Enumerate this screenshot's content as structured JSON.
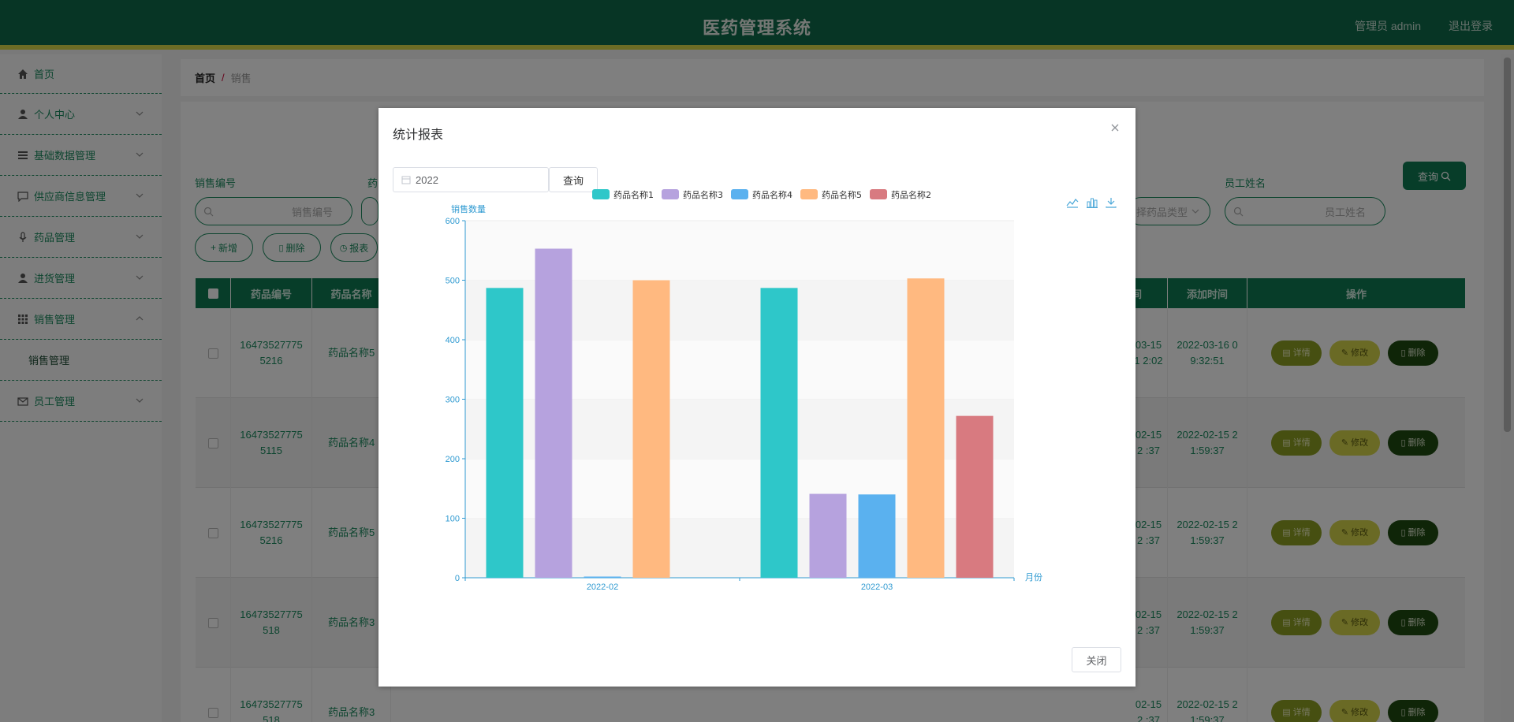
{
  "header": {
    "title": "医药管理系统",
    "user": "管理员 admin",
    "logout": "退出登录"
  },
  "sidebar": {
    "items": [
      {
        "label": "首页",
        "icon": "home-icon"
      },
      {
        "label": "个人中心",
        "icon": "user-icon"
      },
      {
        "label": "基础数据管理",
        "icon": "list-icon"
      },
      {
        "label": "供应商信息管理",
        "icon": "chat-icon"
      },
      {
        "label": "药品管理",
        "icon": "mic-icon"
      },
      {
        "label": "进货管理",
        "icon": "user-icon"
      },
      {
        "label": "销售管理",
        "icon": "grid-icon"
      },
      {
        "label": "员工管理",
        "icon": "mail-icon"
      }
    ],
    "submenu": "销售管理"
  },
  "breadcrumb": {
    "home": "首页",
    "sep": "/",
    "current": "销售"
  },
  "filters": {
    "sale_no_label": "销售编号",
    "sale_no_placeholder": "销售编号",
    "drug_label_partial": "药",
    "drug_type_placeholder": "择药品类型",
    "staff_label": "员工姓名",
    "staff_placeholder": "员工姓名",
    "query": "查询"
  },
  "actions": {
    "add": "新增",
    "delete": "删除",
    "report": "报表"
  },
  "table": {
    "headers": {
      "no": "药品编号",
      "name": "药品名称",
      "time_partial": "间",
      "added": "添加时间",
      "ops": "操作"
    },
    "rows": [
      {
        "no": "16473527775 5216",
        "name": "药品名称5",
        "time": "03-15 1 2:02",
        "added": "2022-03-16 0 9:32:51"
      },
      {
        "no": "16473527775 5115",
        "name": "药品名称4",
        "time": "02-15 2 :37",
        "added": "2022-02-15 2 1:59:37"
      },
      {
        "no": "16473527775 5216",
        "name": "药品名称5",
        "time": "02-15 2 :37",
        "added": "2022-02-15 2 1:59:37"
      },
      {
        "no": "16473527775 518",
        "name": "药品名称3",
        "time": "02-15 2 :37",
        "added": "2022-02-15 2 1:59:37"
      },
      {
        "no": "16473527775 518",
        "name": "药品名称3",
        "time": "02-15 2 :37",
        "added": "2022-02-15 2 1:59:37"
      }
    ],
    "btn_detail": "详情",
    "btn_edit": "修改",
    "btn_delete": "删除"
  },
  "dialog": {
    "title": "统计报表",
    "year_value": "2022",
    "query": "查询",
    "close": "关闭"
  },
  "chart_data": {
    "type": "bar",
    "categories": [
      "2022-02",
      "2022-03"
    ],
    "ylabel": "销售数量",
    "xlabel": "月份",
    "ylim": [
      0,
      600
    ],
    "yticks": [
      0,
      100,
      200,
      300,
      400,
      500,
      600
    ],
    "series": [
      {
        "name": "药品名称1",
        "color": "#2ec7c9",
        "values": [
          487,
          487
        ]
      },
      {
        "name": "药品名称3",
        "color": "#b6a2de",
        "values": [
          553,
          141
        ]
      },
      {
        "name": "药品名称4",
        "color": "#5ab1ef",
        "values": [
          2,
          140
        ]
      },
      {
        "name": "药品名称5",
        "color": "#ffb980",
        "values": [
          500,
          503
        ]
      },
      {
        "name": "药品名称2",
        "color": "#d87a80",
        "values": [
          0,
          272
        ]
      }
    ],
    "legend_position": "top-center",
    "grid": true
  },
  "colors": {
    "brand": "#0e6b4a",
    "accent": "#1a8a5f",
    "header_stripe": "#d8d84a"
  }
}
